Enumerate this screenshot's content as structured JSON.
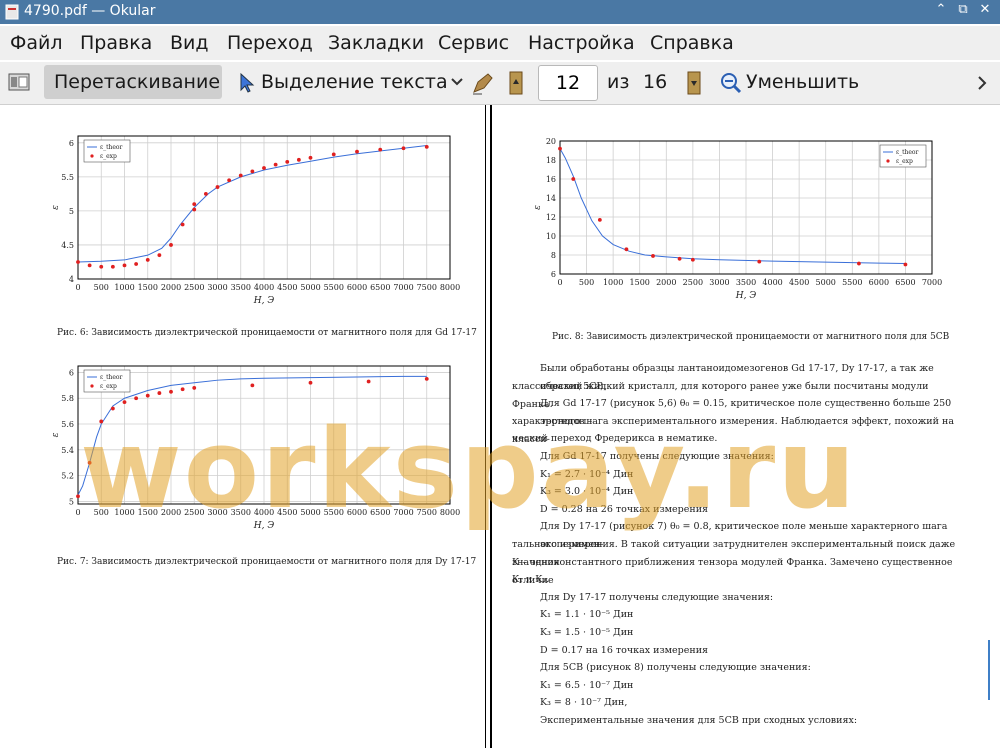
{
  "window": {
    "title": "4790.pdf — Okular",
    "min": "⌃",
    "restore": "⧉",
    "close": "✕"
  },
  "menu": [
    "Файл",
    "Правка",
    "Вид",
    "Переход",
    "Закладки",
    "Сервис",
    "Настройка",
    "Справка"
  ],
  "toolbar": {
    "drag_label": "Перетаскивание",
    "select_label": "Выделение текста",
    "page_current": "12",
    "of_label": "из",
    "page_total": "16",
    "zoom_out_label": "Уменьшить"
  },
  "watermark": "workspay.ru",
  "captions": {
    "fig6": "Рис. 6: Зависимость диэлектрической проницаемости от магнитного поля для Gd 17-17",
    "fig7": "Рис. 7: Зависимость диэлектрической проницаемости от магнитного поля для Dy 17-17",
    "fig8": "Рис. 8: Зависимость диэлектрической проницаемости от магнитного поля для 5CB"
  },
  "text_lines": [
    "Были обработаны образцы лантаноидомезогенов Gd 17-17, Dy 17-17, а так же образец 5CB,",
    "классический жидкий кристалл, для которого ранее уже были посчитаны модули Франка.",
    "Для Gd 17-17 (рисунок 5,6) θ₀ = 0.15, критическое поле существенно больше 250 эрстедов –",
    "характерного шага экспериментального измерения. Наблюдается эффект, похожий на класси-",
    "ческий переход Фредерикса в нематике.",
    "Для Gd 17-17 получены следующие значения:",
    "K₁ = 2.7 · 10⁻⁴ Дин",
    "K₃ = 3.0 · 10⁻⁴ Дин",
    "D = 0.28 на 26 точках измерения",
    "Для Dy 17-17 (рисунок 7) θ₀ = 0.8, критическое поле меньше характерного шага эксперимен-",
    "тального измерения. В такой ситуации затруднителен экспериментальный поиск даже значения",
    "K – одноконстантного приближения тензора модулей Франка. Замечено существенное отличие",
    "K₁ и K₃.",
    "Для Dy 17-17 получены следующие значения:",
    "K₁ = 1.1 · 10⁻⁵ Дин",
    "K₃ = 1.5 · 10⁻⁵ Дин",
    "D = 0.17 на 16 точках измерения",
    "Для 5CB (рисунок 8) получены следующие значения:",
    "K₁ = 6.5 · 10⁻⁷ Дин",
    "K₃ = 8 · 10⁻⁷ Дин,",
    "Экспериментальные значения для 5CB при сходных условиях:"
  ],
  "chart_data": [
    {
      "type": "line",
      "id": "fig6",
      "xlabel": "H, Э",
      "ylabel": "ε",
      "xlim": [
        0,
        8000
      ],
      "ylim": [
        4,
        6.1
      ],
      "xticks": [
        0,
        500,
        1000,
        1500,
        2000,
        2500,
        3000,
        3500,
        4000,
        4500,
        5000,
        5500,
        6000,
        6500,
        7000,
        7500,
        8000
      ],
      "yticks": [
        4,
        4.5,
        5,
        5.5,
        6
      ],
      "legend": [
        "ε_theor",
        "ε_exp"
      ],
      "series": [
        {
          "name": "ε_theor",
          "kind": "line",
          "x": [
            0,
            500,
            1000,
            1500,
            1800,
            2000,
            2200,
            2500,
            2800,
            3000,
            3500,
            4000,
            4500,
            5000,
            5500,
            6000,
            6500,
            7000,
            7500
          ],
          "y": [
            4.25,
            4.26,
            4.28,
            4.35,
            4.45,
            4.6,
            4.8,
            5.05,
            5.25,
            5.35,
            5.5,
            5.6,
            5.67,
            5.73,
            5.79,
            5.84,
            5.88,
            5.92,
            5.96
          ]
        },
        {
          "name": "ε_exp",
          "kind": "scatter",
          "x": [
            0,
            250,
            500,
            750,
            1000,
            1250,
            1500,
            1750,
            2000,
            2250,
            2500,
            2500,
            2750,
            3000,
            3250,
            3500,
            3750,
            4000,
            4250,
            4500,
            4750,
            5000,
            5500,
            6000,
            6500,
            7000,
            7500
          ],
          "y": [
            4.25,
            4.2,
            4.18,
            4.18,
            4.2,
            4.22,
            4.28,
            4.35,
            4.5,
            4.8,
            5.02,
            5.1,
            5.25,
            5.35,
            5.45,
            5.52,
            5.58,
            5.63,
            5.68,
            5.72,
            5.75,
            5.78,
            5.83,
            5.87,
            5.9,
            5.92,
            5.94
          ]
        }
      ]
    },
    {
      "type": "line",
      "id": "fig7",
      "xlabel": "H, Э",
      "ylabel": "ε",
      "xlim": [
        0,
        8000
      ],
      "ylim": [
        4.98,
        6.05
      ],
      "xticks": [
        0,
        500,
        1000,
        1500,
        2000,
        2500,
        3000,
        3500,
        4000,
        4500,
        5000,
        5500,
        6000,
        6500,
        7000,
        7500,
        8000
      ],
      "yticks": [
        5,
        5.2,
        5.4,
        5.6,
        5.8,
        6
      ],
      "legend": [
        "ε_theor",
        "ε_exp"
      ],
      "series": [
        {
          "name": "ε_theor",
          "kind": "line",
          "x": [
            0,
            100,
            250,
            400,
            500,
            750,
            1000,
            1500,
            2000,
            2500,
            3000,
            3500,
            4000,
            5000,
            6000,
            7000,
            7500
          ],
          "y": [
            5.05,
            5.12,
            5.3,
            5.5,
            5.6,
            5.74,
            5.8,
            5.86,
            5.9,
            5.92,
            5.94,
            5.95,
            5.955,
            5.96,
            5.965,
            5.97,
            5.97
          ]
        },
        {
          "name": "ε_exp",
          "kind": "scatter",
          "x": [
            0,
            250,
            500,
            750,
            1000,
            1250,
            1500,
            1750,
            2000,
            2250,
            2500,
            3750,
            5000,
            6250,
            7500
          ],
          "y": [
            5.04,
            5.3,
            5.62,
            5.72,
            5.77,
            5.8,
            5.82,
            5.84,
            5.85,
            5.87,
            5.88,
            5.9,
            5.92,
            5.93,
            5.95
          ]
        }
      ]
    },
    {
      "type": "line",
      "id": "fig8",
      "xlabel": "H, Э",
      "ylabel": "ε",
      "xlim": [
        0,
        7000
      ],
      "ylim": [
        6,
        20
      ],
      "xticks": [
        0,
        500,
        1000,
        1500,
        2000,
        2500,
        3000,
        3500,
        4000,
        4500,
        5000,
        5500,
        6000,
        6500,
        7000
      ],
      "yticks": [
        6,
        8,
        10,
        12,
        14,
        16,
        18,
        20
      ],
      "legend": [
        "ε_theor",
        "ε_exp"
      ],
      "series": [
        {
          "name": "ε_theor",
          "kind": "line",
          "x": [
            0,
            100,
            250,
            400,
            600,
            800,
            1000,
            1300,
            1600,
            2000,
            2500,
            3000,
            4000,
            5000,
            6000,
            6500
          ],
          "y": [
            19.2,
            18.2,
            16.3,
            14,
            11.6,
            10,
            9.1,
            8.4,
            8.0,
            7.8,
            7.6,
            7.5,
            7.35,
            7.25,
            7.15,
            7.1
          ]
        },
        {
          "name": "ε_exp",
          "kind": "scatter",
          "x": [
            0,
            250,
            750,
            1250,
            1750,
            2250,
            2500,
            3750,
            5625,
            6500
          ],
          "y": [
            19.2,
            16.0,
            11.7,
            8.6,
            7.9,
            7.6,
            7.5,
            7.3,
            7.1,
            7.0
          ]
        }
      ]
    }
  ]
}
